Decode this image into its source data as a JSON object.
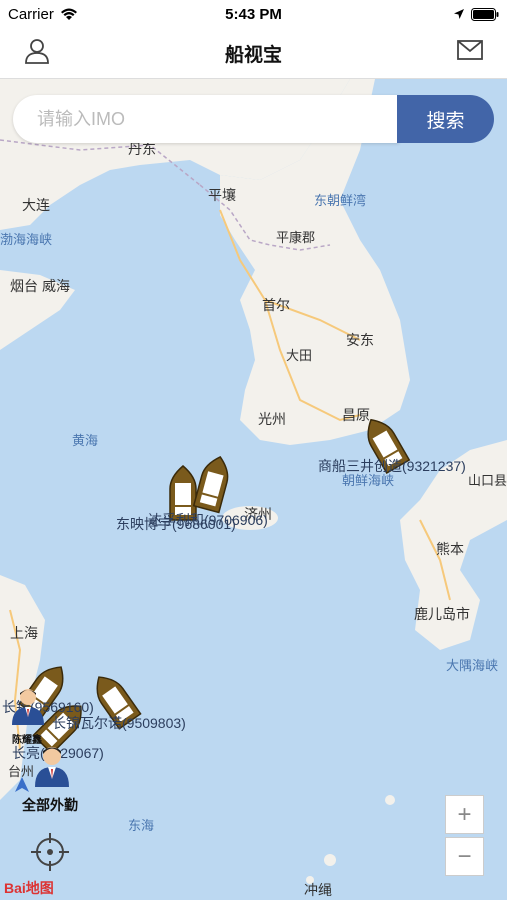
{
  "status": {
    "carrier": "Carrier",
    "time": "5:43 PM"
  },
  "nav": {
    "title": "船视宝"
  },
  "search": {
    "placeholder": "请输入IMO",
    "button": "搜索"
  },
  "map": {
    "places": [
      {
        "name": "丹东",
        "cls": "big"
      },
      {
        "name": "平壤",
        "cls": "big"
      },
      {
        "name": "东朝鲜湾",
        "cls": "sea"
      },
      {
        "name": "大连",
        "cls": "big"
      },
      {
        "name": "渤海海峡",
        "cls": "sea"
      },
      {
        "name": "平康郡",
        "cls": ""
      },
      {
        "name": "烟台",
        "cls": "big"
      },
      {
        "name": "威海",
        "cls": "big"
      },
      {
        "name": "首尔",
        "cls": "big"
      },
      {
        "name": "安东",
        "cls": "big"
      },
      {
        "name": "大田",
        "cls": ""
      },
      {
        "name": "光州",
        "cls": "big"
      },
      {
        "name": "昌原",
        "cls": "big"
      },
      {
        "name": "黄海",
        "cls": "sea"
      },
      {
        "name": "朝鲜海峡",
        "cls": "sea"
      },
      {
        "name": "济州",
        "cls": "big"
      },
      {
        "name": "山口县",
        "cls": ""
      },
      {
        "name": "熊本",
        "cls": "big"
      },
      {
        "name": "鹿儿岛市",
        "cls": "big"
      },
      {
        "name": "大隅海峡",
        "cls": "sea"
      },
      {
        "name": "上海",
        "cls": "big"
      },
      {
        "name": "台州",
        "cls": ""
      },
      {
        "name": "东海",
        "cls": "sea"
      },
      {
        "name": "冲绳",
        "cls": "big"
      }
    ],
    "ships": [
      {
        "label": "商船三井创造(9321237)"
      },
      {
        "label": "东映博宇(9686001)"
      },
      {
        "label": "达孚利和(9706906)"
      },
      {
        "label": "长锦瓦尔诺(9509803)"
      },
      {
        "label": "长锦(9569160)"
      },
      {
        "label": "长亮(9629067)"
      }
    ],
    "staff": [
      {
        "label": "陈耀鑫"
      },
      {
        "label": "全部外勤"
      }
    ],
    "zoom_in": "+",
    "zoom_out": "−",
    "attribution": "Bai地图"
  }
}
